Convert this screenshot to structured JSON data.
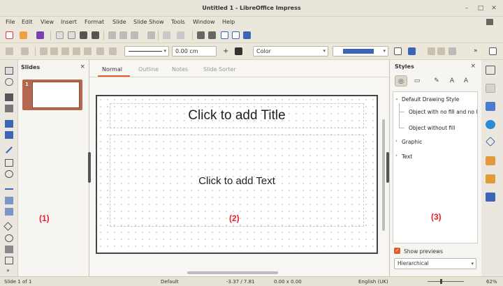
{
  "window": {
    "title": "Untitled 1 - LibreOffice Impress",
    "minimize": "–",
    "maximize": "□",
    "close": "✕"
  },
  "menu": [
    "File",
    "Edit",
    "View",
    "Insert",
    "Format",
    "Slide",
    "Slide Show",
    "Tools",
    "Window",
    "Help"
  ],
  "toolbar2": {
    "line_width": "0.00 cm",
    "area_style": "Color",
    "plus": "+",
    "more": "»"
  },
  "slides_pane": {
    "title": "Slides",
    "close": "×",
    "slide_number": "1",
    "marker": "(1)"
  },
  "view_tabs": [
    "Normal",
    "Outline",
    "Notes",
    "Slide Sorter"
  ],
  "slide": {
    "title_placeholder": "Click to add Title",
    "text_placeholder": "Click to add Text",
    "marker": "(2)"
  },
  "styles_pane": {
    "title": "Styles",
    "close": "×",
    "tree": {
      "root": "Default Drawing Style",
      "child1": "Object with no fill and no line",
      "child2": "Object without fill",
      "group1": "Graphic",
      "group2": "Text"
    },
    "show_previews": "Show previews",
    "filter": "Hierarchical",
    "marker": "(3)"
  },
  "statusbar": {
    "slide_info": "Slide 1 of 1",
    "layout": "Default",
    "position": "-3.37 / 7.81",
    "size": "0.00 x 0.00",
    "language": "English (UK)",
    "zoom": "62%"
  },
  "colors": {
    "accent": "#e05a2b",
    "marker": "#e8202a",
    "thumb_frame": "#b5664f",
    "line_color": "#3a66b5"
  }
}
